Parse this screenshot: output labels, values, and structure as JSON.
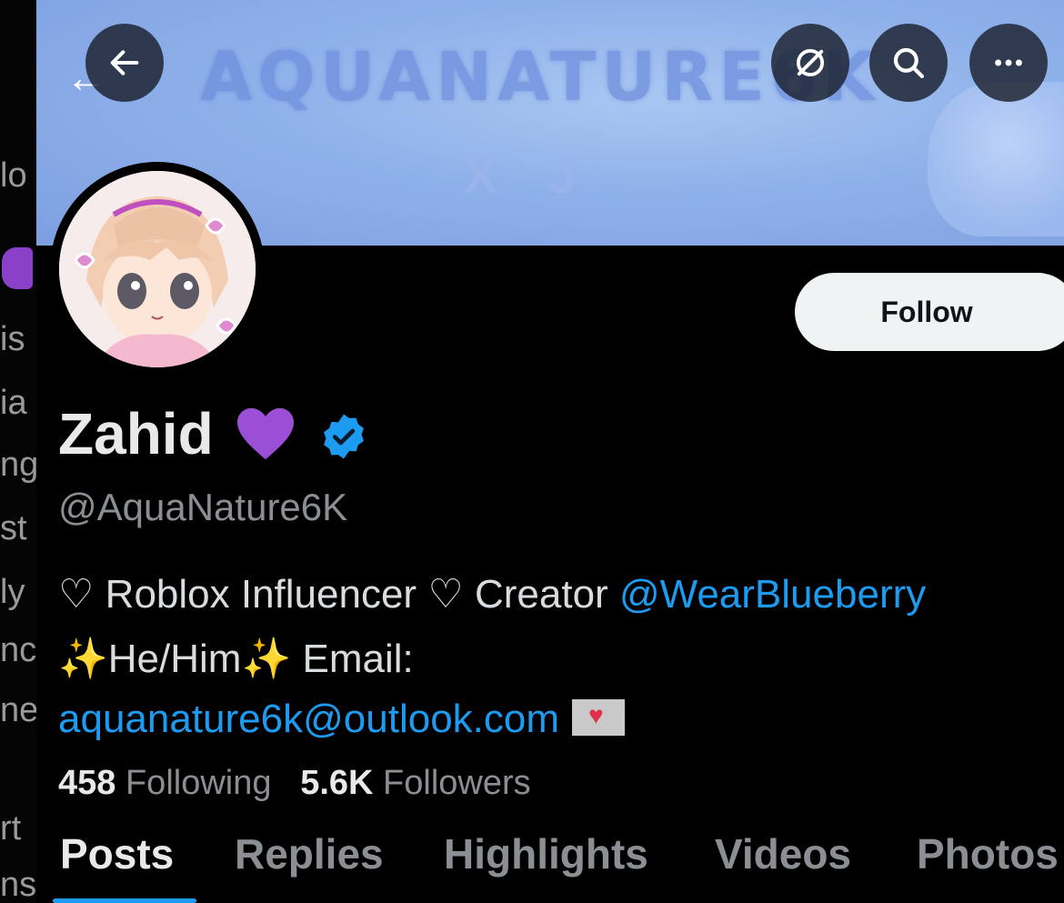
{
  "left_strip": [
    "lo",
    "is",
    "ia",
    "ng",
    "st",
    "ly",
    "nc",
    "ne",
    "rt",
    "ns"
  ],
  "banner": {
    "title": "AQUANATURE6K",
    "subtitle": "X J"
  },
  "top_buttons": {
    "back_icon": "arrow-left-icon",
    "grok_icon": "slash-circle-icon",
    "search_icon": "search-icon",
    "more_icon": "more-horizontal-icon"
  },
  "follow_button": "Follow",
  "profile": {
    "name": "Zahid",
    "handle": "@AquaNature6K",
    "bio_line1_text": "♡ Roblox Influencer ♡ Creator ",
    "bio_line1_link": "@WearBlueberry",
    "bio_line2_text": "✨He/Him✨ Email:",
    "bio_line3_link": "aquanature6k@outlook.com"
  },
  "stats": {
    "following_count": "458",
    "following_label": "Following",
    "followers_count": "5.6K",
    "followers_label": "Followers"
  },
  "tabs": [
    "Posts",
    "Replies",
    "Highlights",
    "Videos",
    "Photos"
  ],
  "colors": {
    "accent": "#1d9bf0",
    "heart": "#8a40c9",
    "background": "#000000"
  }
}
